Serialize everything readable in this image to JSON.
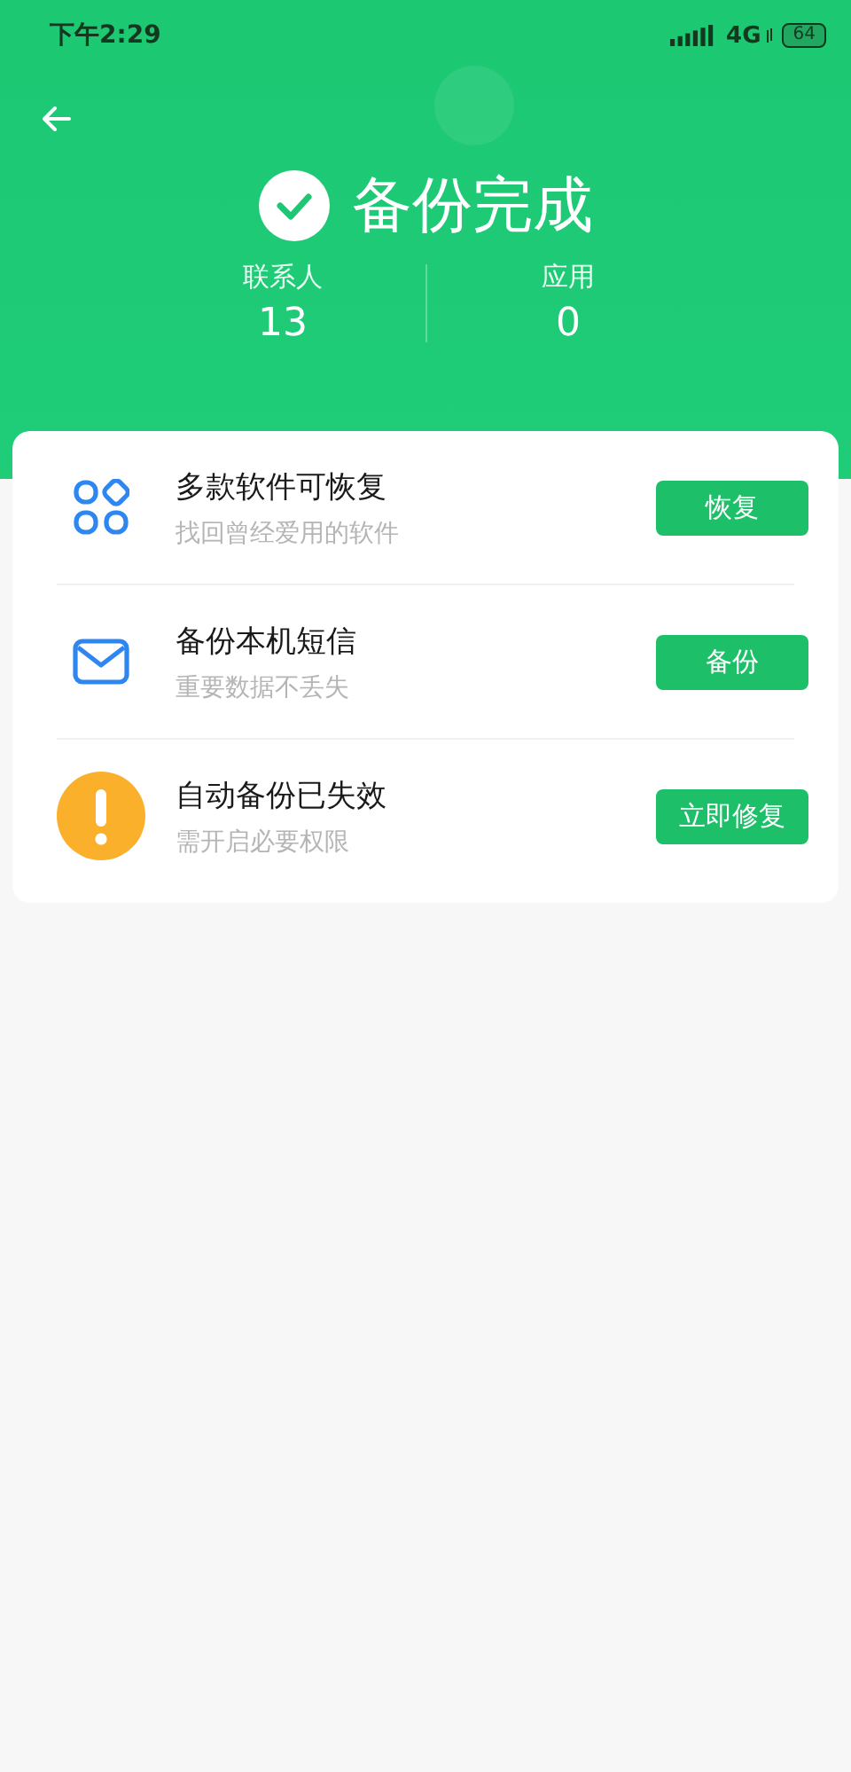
{
  "status_bar": {
    "time": "下午2:29",
    "network": "4G",
    "battery": "64"
  },
  "header": {
    "title": "备份完成",
    "stats": [
      {
        "label": "联系人",
        "value": "13"
      },
      {
        "label": "应用",
        "value": "0"
      }
    ]
  },
  "items": [
    {
      "kind": "apps",
      "title": "多款软件可恢复",
      "subtitle": "找回曾经爱用的软件",
      "button": "恢复"
    },
    {
      "kind": "mail",
      "title": "备份本机短信",
      "subtitle": "重要数据不丢失",
      "button": "备份"
    },
    {
      "kind": "warning",
      "title": "自动备份已失效",
      "subtitle": "需开启必要权限",
      "button": "立即修复"
    }
  ]
}
